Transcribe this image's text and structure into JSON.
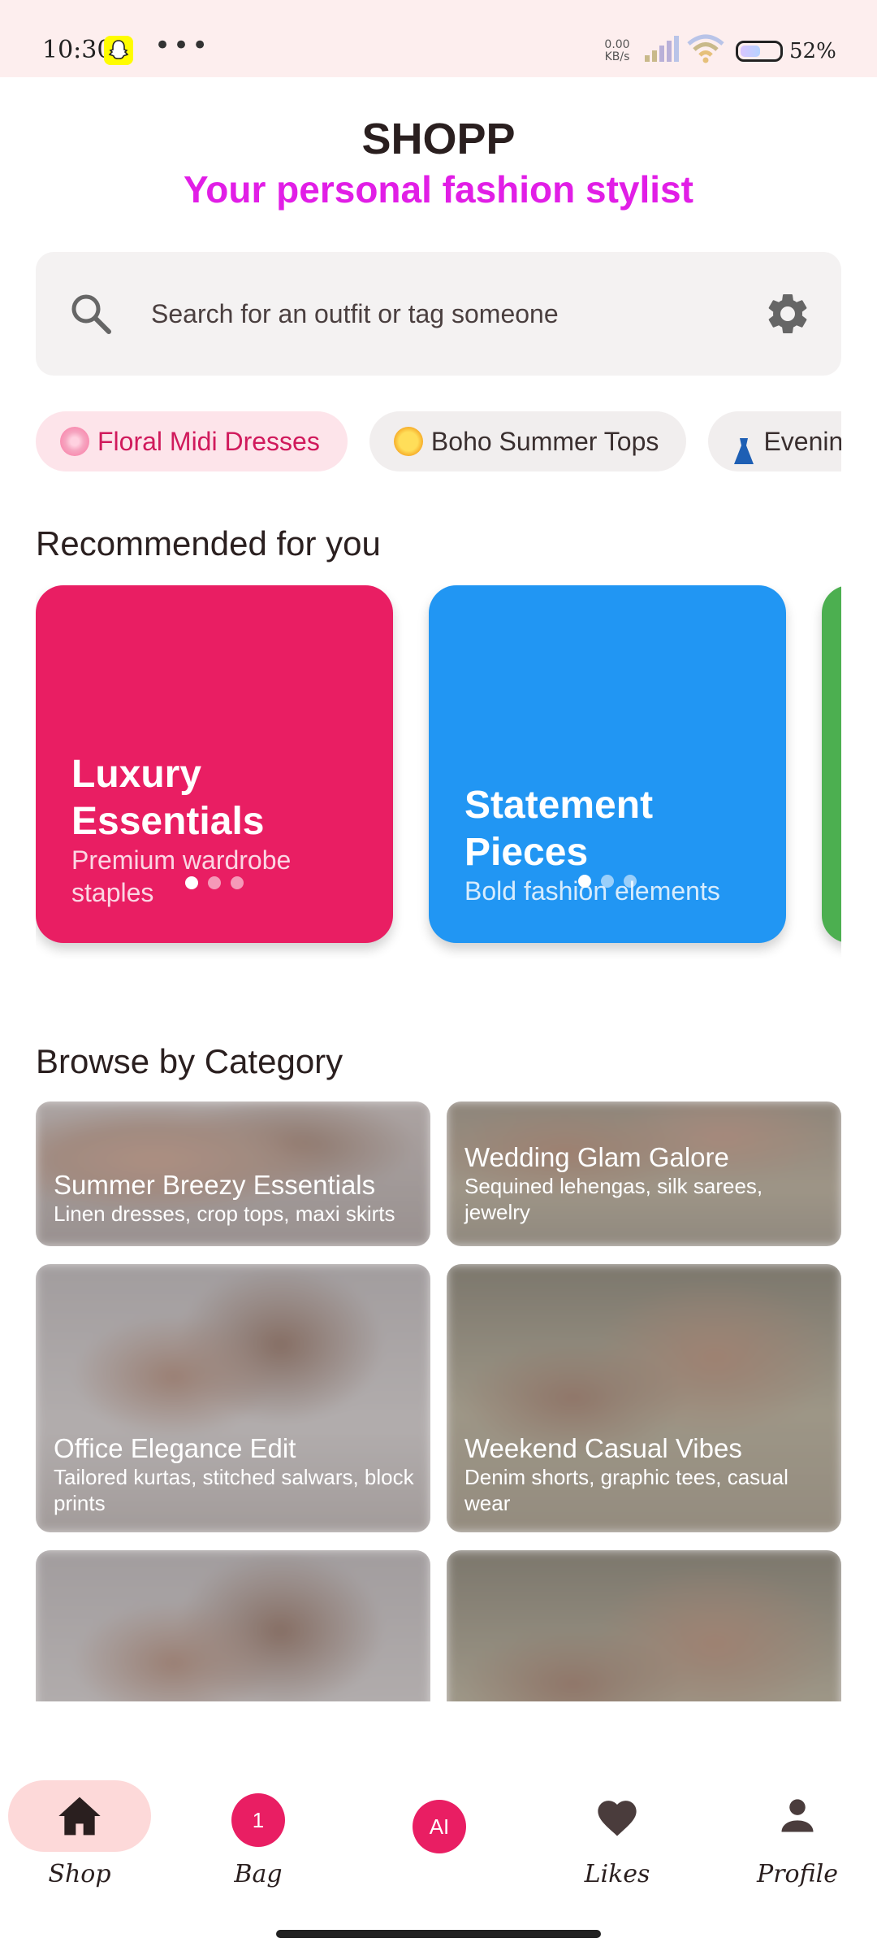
{
  "status_bar": {
    "time": "10:30",
    "more": "•••",
    "net_speed_value": "0.00",
    "net_speed_unit": "KB/s",
    "battery_percent": "52%",
    "battery_level": 0.52
  },
  "header": {
    "title": "SHOPP",
    "subtitle": "Your personal fashion stylist",
    "subtitle_color": "#e11ee6"
  },
  "search": {
    "placeholder": "Search for an outfit or tag someone"
  },
  "chips": [
    {
      "label": "Floral Midi Dresses",
      "emoji": "flower-emoji",
      "active": true
    },
    {
      "label": "Boho Summer Tops",
      "emoji": "sun-emoji",
      "active": false
    },
    {
      "label": "Evening",
      "emoji": "dress-emoji",
      "active": false
    }
  ],
  "recommended": {
    "title": "Recommended for you",
    "cards": [
      {
        "title": "Luxury Essentials",
        "subtitle": "Premium wardrobe staples",
        "color": "#e91e63"
      },
      {
        "title": "Statement Pieces",
        "subtitle": "Bold fashion elements",
        "color": "#2196f3"
      },
      {
        "title": "",
        "subtitle": "",
        "color": "#4caf50"
      }
    ]
  },
  "categories": {
    "title": "Browse by Category",
    "items": [
      {
        "title": "Summer Breezy Essentials",
        "subtitle": "Linen dresses, crop tops, maxi skirts"
      },
      {
        "title": "Wedding Glam Galore",
        "subtitle": "Sequined lehengas, silk sarees, jewelry"
      },
      {
        "title": "Office Elegance Edit",
        "subtitle": "Tailored kurtas, stitched salwars, block prints"
      },
      {
        "title": "Weekend Casual Vibes",
        "subtitle": "Denim shorts, graphic tees, casual wear"
      },
      {
        "title": "",
        "subtitle": ""
      },
      {
        "title": "",
        "subtitle": ""
      }
    ]
  },
  "bottom_nav": {
    "shop": "Shop",
    "bag": "Bag",
    "bag_count": "1",
    "ai": "AI",
    "likes": "Likes",
    "profile": "Profile"
  },
  "colors": {
    "accent_pink": "#e91e63",
    "accent_blue": "#2196f3",
    "accent_green": "#4caf50",
    "nav_active": "#fdd9d9"
  }
}
